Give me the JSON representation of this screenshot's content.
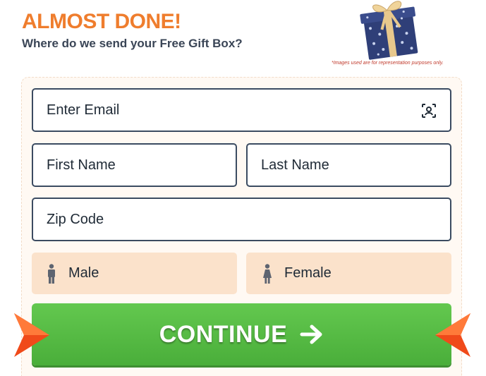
{
  "header": {
    "headline": "ALMOST DONE!",
    "subheadline": "Where do we send your Free Gift Box?",
    "disclaimer": "*Images used are for representation purposes only."
  },
  "form": {
    "email": {
      "placeholder": "Enter Email",
      "value": "",
      "icon": "contact-card-icon"
    },
    "first_name": {
      "placeholder": "First Name",
      "value": ""
    },
    "last_name": {
      "placeholder": "Last Name",
      "value": ""
    },
    "zip": {
      "placeholder": "Zip Code",
      "value": ""
    },
    "gender_options": [
      {
        "label": "Male",
        "icon": "male-icon"
      },
      {
        "label": "Female",
        "icon": "female-icon"
      }
    ],
    "submit_label": "CONTINUE",
    "submit_icon": "arrow-right-icon"
  },
  "images": {
    "gift": "gift-box-image"
  },
  "colors": {
    "headline": "#ef7d2d",
    "subheadline": "#3a4556",
    "field_border": "#3b4b61",
    "gender_bg": "#fbe2cb",
    "button_green": "#4aae3a",
    "pointer_orange": "#f04a1a"
  }
}
